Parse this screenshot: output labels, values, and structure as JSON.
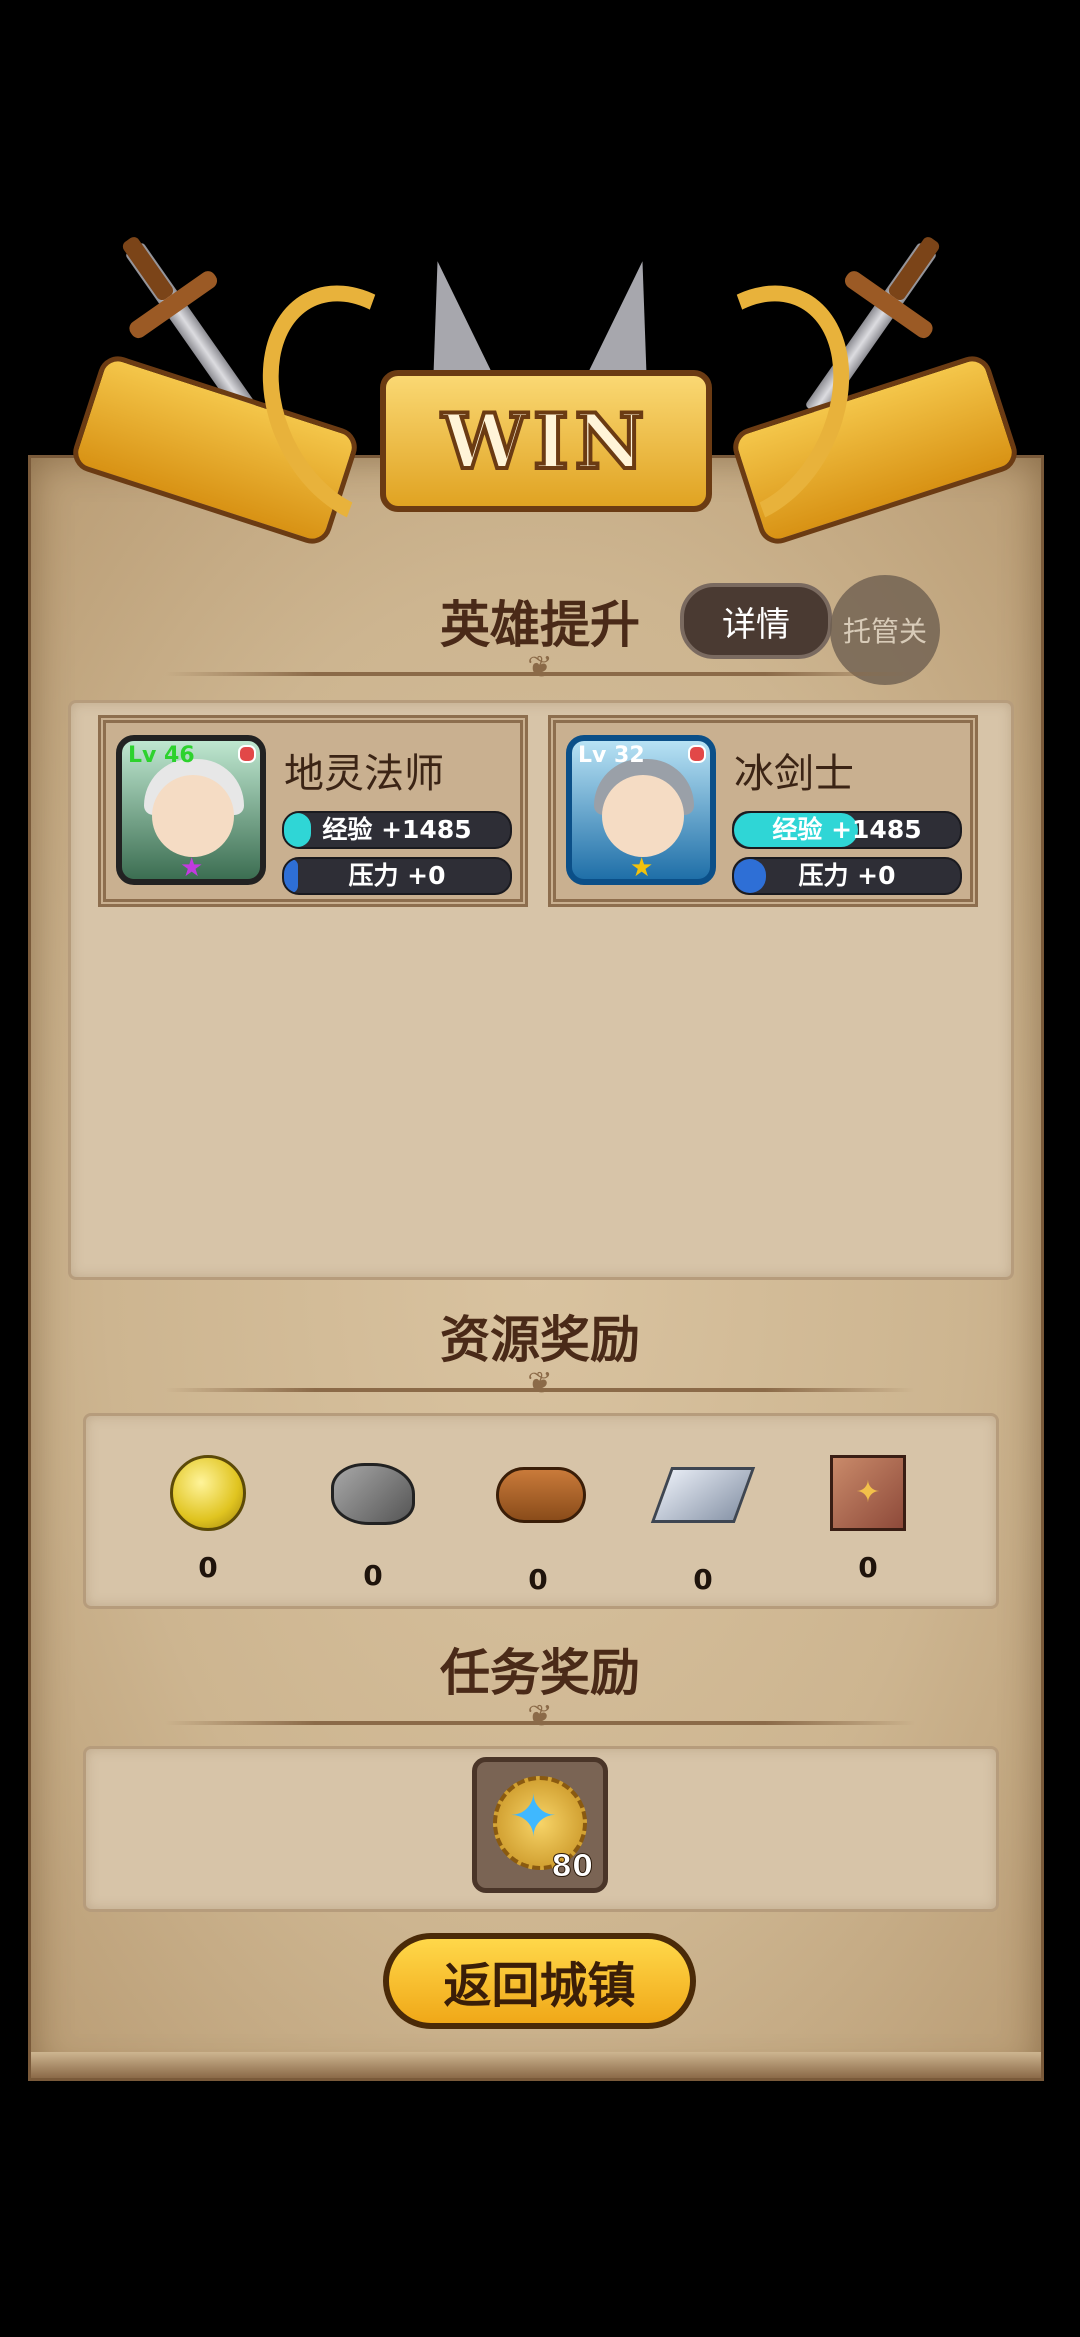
{
  "banner": {
    "text": "WIN"
  },
  "hero_section": {
    "title": "英雄提升",
    "detail_label": "详情",
    "auto_label": "托管关",
    "heroes": [
      {
        "name": "地灵法师",
        "level": "Lv 46",
        "exp_label": "经验 +1485",
        "pressure_label": "压力 +0",
        "star": "★",
        "star_color": "#c23ae0",
        "frame": "green",
        "exp_fill": 0.12,
        "pressure_fill": 0.06
      },
      {
        "name": "冰剑士",
        "level": "Lv 32",
        "exp_label": "经验 +1485",
        "pressure_label": "压力 +0",
        "star": "★",
        "star_color": "#f2c20c",
        "frame": "blue",
        "exp_fill": 0.55,
        "pressure_fill": 0.14
      }
    ]
  },
  "resource_section": {
    "title": "资源奖励",
    "items": [
      {
        "icon": "gold-coin-icon",
        "count": "0"
      },
      {
        "icon": "stone-icon",
        "count": "0"
      },
      {
        "icon": "wood-log-icon",
        "count": "0"
      },
      {
        "icon": "iron-ingot-icon",
        "count": "0"
      },
      {
        "icon": "cloth-icon",
        "count": "0"
      }
    ]
  },
  "task_section": {
    "title": "任务奖励",
    "reward": {
      "icon": "medal-icon",
      "count": "80"
    }
  },
  "footer": {
    "return_label": "返回城镇"
  }
}
